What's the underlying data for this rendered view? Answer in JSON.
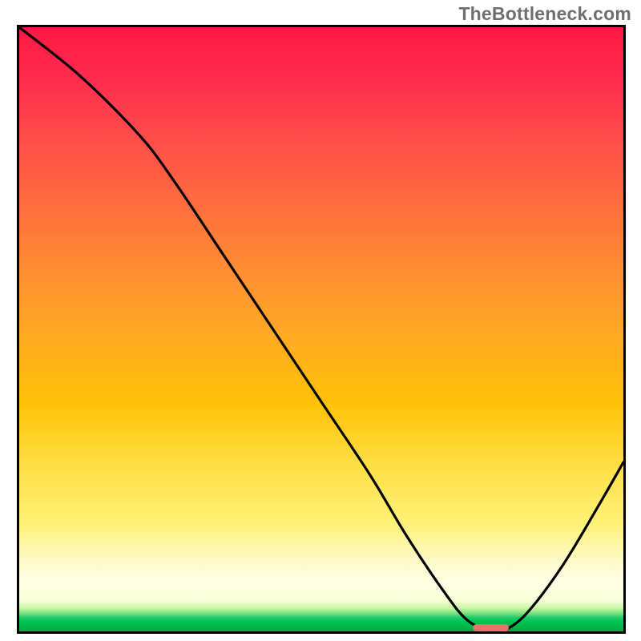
{
  "watermark_text": "TheBottleneck.com",
  "colors": {
    "border": "#000000",
    "curve": "#000000",
    "marker": "#e8736b",
    "gradient_top": "#ff1744",
    "gradient_mid_orange": "#ff8d33",
    "gradient_yellow": "#ffe24d",
    "gradient_green": "#00c853"
  },
  "chart_data": {
    "type": "line",
    "title": "",
    "xlabel": "",
    "ylabel": "",
    "xlim": [
      0,
      100
    ],
    "ylim": [
      0,
      100
    ],
    "note": "Axes are unlabeled; values are percentage positions of the plotted curve within the gradient square, estimated from pixels. y=100 is top of plot, y=0 is bottom.",
    "series": [
      {
        "name": "bottleneck-curve",
        "x": [
          0,
          10,
          20,
          26,
          34,
          42,
          50,
          58,
          64,
          70,
          74,
          78,
          80,
          84,
          90,
          96,
          100
        ],
        "y": [
          100,
          92,
          82,
          74,
          62,
          50,
          38,
          26,
          16,
          7,
          2,
          0,
          0,
          3,
          11,
          21,
          28
        ]
      }
    ],
    "marker": {
      "name": "optimal-range",
      "x_center": 78,
      "y": 0.6,
      "width_pct": 6.0,
      "height_pct": 1.3
    }
  }
}
